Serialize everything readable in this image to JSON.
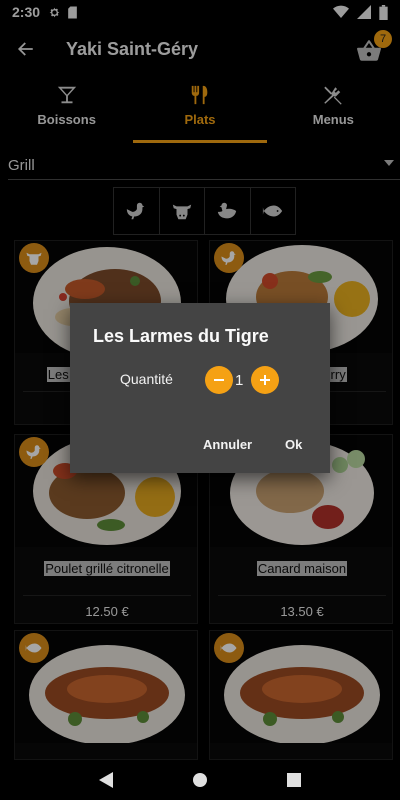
{
  "status": {
    "time": "2:30"
  },
  "header": {
    "title": "Yaki Saint-Géry",
    "cart_count": "7"
  },
  "tabs": [
    {
      "label": "Boissons",
      "icon": "cocktail-icon"
    },
    {
      "label": "Plats",
      "icon": "fork-knife-icon",
      "active": true
    },
    {
      "label": "Menus",
      "icon": "utensils-crossed-icon"
    }
  ],
  "category": {
    "selected": "Grill"
  },
  "filters": [
    "chicken-icon",
    "cow-icon",
    "duck-icon",
    "fish-icon"
  ],
  "dishes": [
    {
      "name": "Les Larmes du Tigre",
      "price": "",
      "badge": "cow-icon"
    },
    {
      "name": "Poulet au curry",
      "price": "",
      "badge": "chicken-icon"
    },
    {
      "name": "Poulet grillé citronelle",
      "price": "12.50 €",
      "badge": "chicken-icon"
    },
    {
      "name": "Canard maison",
      "price": "13.50 €",
      "badge": "duck-icon"
    },
    {
      "name": "",
      "price": "",
      "badge": "fish-icon"
    },
    {
      "name": "",
      "price": "",
      "badge": "fish-icon"
    }
  ],
  "dialog": {
    "title": "Les Larmes du Tigre",
    "quantity_label": "Quantité",
    "quantity": "1",
    "cancel_label": "Annuler",
    "ok_label": "Ok"
  },
  "colors": {
    "accent": "#f5a114",
    "dialog_bg": "#444444"
  }
}
